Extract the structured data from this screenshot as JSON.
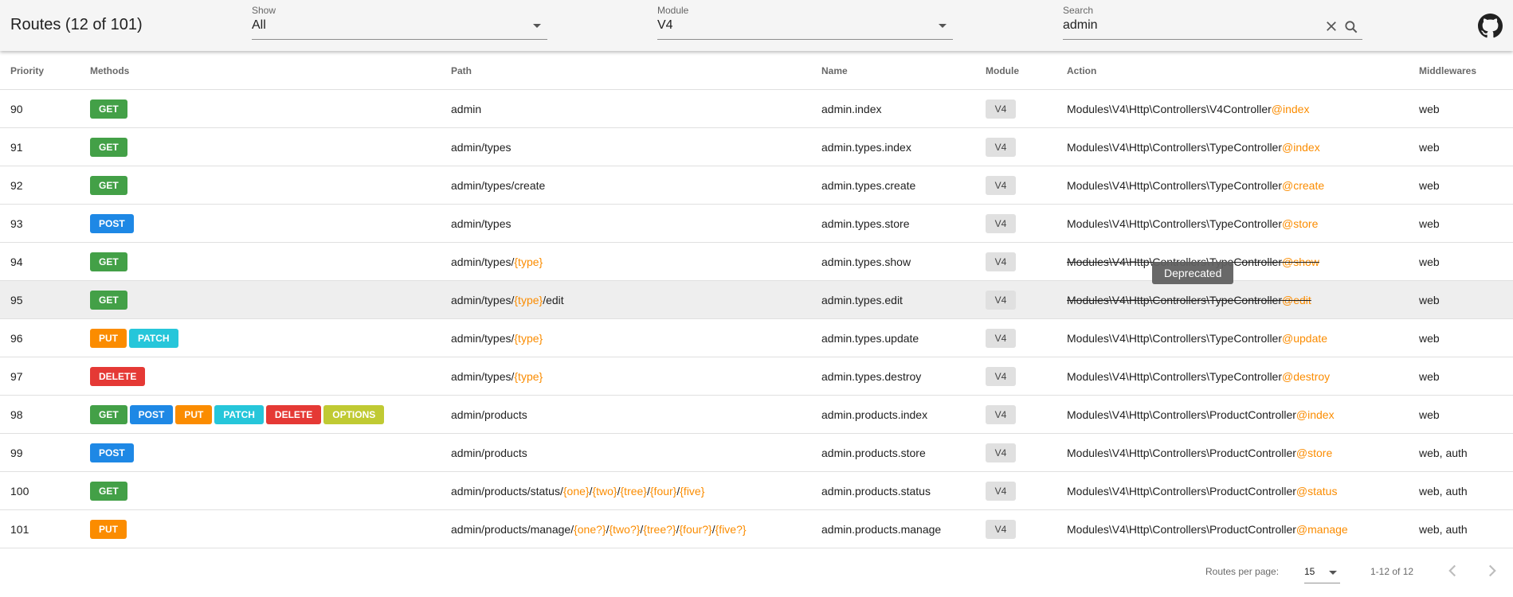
{
  "app": {
    "title": "Routes (12 of 101)"
  },
  "filters": {
    "show": {
      "label": "Show",
      "value": "All"
    },
    "module": {
      "label": "Module",
      "value": "V4"
    },
    "search": {
      "label": "Search",
      "value": "admin"
    }
  },
  "columns": [
    "Priority",
    "Methods",
    "Path",
    "Name",
    "Module",
    "Action",
    "Middlewares"
  ],
  "colors": {
    "GET": "#43a047",
    "POST": "#1e88e5",
    "PUT": "#fb8c00",
    "PATCH": "#26c6da",
    "DELETE": "#e53935",
    "OPTIONS": "#c0ca33",
    "param": "#fb8c00",
    "hover_row": "#eeeeee"
  },
  "rows": [
    {
      "priority": "90",
      "methods": [
        "GET"
      ],
      "path": [
        "admin"
      ],
      "name": "admin.index",
      "module": "V4",
      "controller": "Modules\\V4\\Http\\Controllers\\V4Controller",
      "method": "@index",
      "middlewares": "web",
      "deprecated": false
    },
    {
      "priority": "91",
      "methods": [
        "GET"
      ],
      "path": [
        "admin/types"
      ],
      "name": "admin.types.index",
      "module": "V4",
      "controller": "Modules\\V4\\Http\\Controllers\\TypeController",
      "method": "@index",
      "middlewares": "web",
      "deprecated": false
    },
    {
      "priority": "92",
      "methods": [
        "GET"
      ],
      "path": [
        "admin/types/create"
      ],
      "name": "admin.types.create",
      "module": "V4",
      "controller": "Modules\\V4\\Http\\Controllers\\TypeController",
      "method": "@create",
      "middlewares": "web",
      "deprecated": false
    },
    {
      "priority": "93",
      "methods": [
        "POST"
      ],
      "path": [
        "admin/types"
      ],
      "name": "admin.types.store",
      "module": "V4",
      "controller": "Modules\\V4\\Http\\Controllers\\TypeController",
      "method": "@store",
      "middlewares": "web",
      "deprecated": false
    },
    {
      "priority": "94",
      "methods": [
        "GET"
      ],
      "path": [
        "admin/types/",
        "{type}"
      ],
      "name": "admin.types.show",
      "module": "V4",
      "controller": "Modules\\V4\\Http\\Controllers\\TypeController",
      "method": "@show",
      "middlewares": "web",
      "deprecated": true
    },
    {
      "priority": "95",
      "methods": [
        "GET"
      ],
      "path": [
        "admin/types/",
        "{type}",
        "/edit"
      ],
      "name": "admin.types.edit",
      "module": "V4",
      "controller": "Modules\\V4\\Http\\Controllers\\TypeController",
      "method": "@edit",
      "middlewares": "web",
      "deprecated": true,
      "hovered": true
    },
    {
      "priority": "96",
      "methods": [
        "PUT",
        "PATCH"
      ],
      "path": [
        "admin/types/",
        "{type}"
      ],
      "name": "admin.types.update",
      "module": "V4",
      "controller": "Modules\\V4\\Http\\Controllers\\TypeController",
      "method": "@update",
      "middlewares": "web",
      "deprecated": false
    },
    {
      "priority": "97",
      "methods": [
        "DELETE"
      ],
      "path": [
        "admin/types/",
        "{type}"
      ],
      "name": "admin.types.destroy",
      "module": "V4",
      "controller": "Modules\\V4\\Http\\Controllers\\TypeController",
      "method": "@destroy",
      "middlewares": "web",
      "deprecated": false
    },
    {
      "priority": "98",
      "methods": [
        "GET",
        "POST",
        "PUT",
        "PATCH",
        "DELETE",
        "OPTIONS"
      ],
      "path": [
        "admin/products"
      ],
      "name": "admin.products.index",
      "module": "V4",
      "controller": "Modules\\V4\\Http\\Controllers\\ProductController",
      "method": "@index",
      "middlewares": "web",
      "deprecated": false
    },
    {
      "priority": "99",
      "methods": [
        "POST"
      ],
      "path": [
        "admin/products"
      ],
      "name": "admin.products.store",
      "module": "V4",
      "controller": "Modules\\V4\\Http\\Controllers\\ProductController",
      "method": "@store",
      "middlewares": "web, auth",
      "deprecated": false
    },
    {
      "priority": "100",
      "methods": [
        "GET"
      ],
      "path": [
        "admin/products/status/",
        "{one}",
        "/",
        "{two}",
        "/",
        "{tree}",
        "/",
        "{four}",
        "/",
        "{five}"
      ],
      "name": "admin.products.status",
      "module": "V4",
      "controller": "Modules\\V4\\Http\\Controllers\\ProductController",
      "method": "@status",
      "middlewares": "web, auth",
      "deprecated": false
    },
    {
      "priority": "101",
      "methods": [
        "PUT"
      ],
      "path": [
        "admin/products/manage/",
        "{one?}",
        "/",
        "{two?}",
        "/",
        "{tree?}",
        "/",
        "{four?}",
        "/",
        "{five?}"
      ],
      "name": "admin.products.manage",
      "module": "V4",
      "controller": "Modules\\V4\\Http\\Controllers\\ProductController",
      "method": "@manage",
      "middlewares": "web, auth",
      "deprecated": false
    }
  ],
  "tooltip": {
    "text": "Deprecated"
  },
  "pagination": {
    "rows_per_page_label": "Routes per page:",
    "rows_per_page": "15",
    "range": "1-12 of 12"
  },
  "icons": {
    "dropdown": "chevron-down-icon",
    "clear": "close-icon",
    "search": "search-icon",
    "github": "github-icon",
    "prev": "chevron-left-icon",
    "next": "chevron-right-icon"
  }
}
